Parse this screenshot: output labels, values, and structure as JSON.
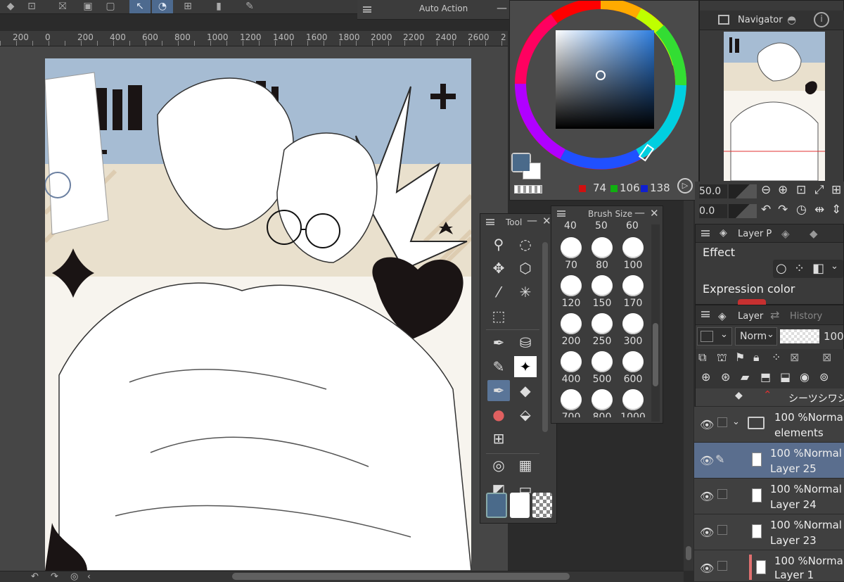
{
  "top_toolbar": {
    "icons": [
      "snap-icon",
      "ruler-icon",
      "special-ruler-icon",
      "frame-icon",
      "perspective-icon",
      "grid-icon",
      "transform-icon",
      "phone-icon",
      "help-icon"
    ]
  },
  "auto_action": {
    "title": "Auto Action"
  },
  "ruler": {
    "labels": [
      "200",
      "0",
      "200",
      "400",
      "600",
      "800",
      "1000",
      "1200",
      "1400",
      "1600",
      "1800",
      "2000",
      "2200",
      "2400",
      "2600",
      "2"
    ]
  },
  "color": {
    "r": "74",
    "g": "106",
    "b": "138",
    "main_color": "#4a6a8a",
    "sub_color": "#ffffff"
  },
  "navigator": {
    "title": "Navigator"
  },
  "nav_controls": {
    "zoom": "50.0",
    "angle": "0.0"
  },
  "tool_panel": {
    "title": "Tool"
  },
  "brush_panel": {
    "title": "Brush Size",
    "top_row": [
      "40",
      "50",
      "60"
    ],
    "sizes": [
      "70",
      "80",
      "100",
      "120",
      "150",
      "170",
      "200",
      "250",
      "300",
      "400",
      "500",
      "600",
      "700",
      "800",
      "1000"
    ]
  },
  "layer_property": {
    "tab": "Layer P",
    "effect_label": "Effect",
    "expression_label": "Expression color"
  },
  "layer_panel": {
    "tab_layer": "Layer",
    "tab_history": "History",
    "blend_mode": "Norm",
    "opacity": "100",
    "partial_row_name": "シーツシワシ",
    "layers": [
      {
        "top": "100 %Normal",
        "name": "elements"
      },
      {
        "top": "100 %Normal",
        "name": "Layer 25"
      },
      {
        "top": "100 %Normal",
        "name": "Layer 24"
      },
      {
        "top": "100 %Normal",
        "name": "Layer 23"
      },
      {
        "top": "100 %Normal",
        "name": "Layer 1"
      }
    ]
  }
}
